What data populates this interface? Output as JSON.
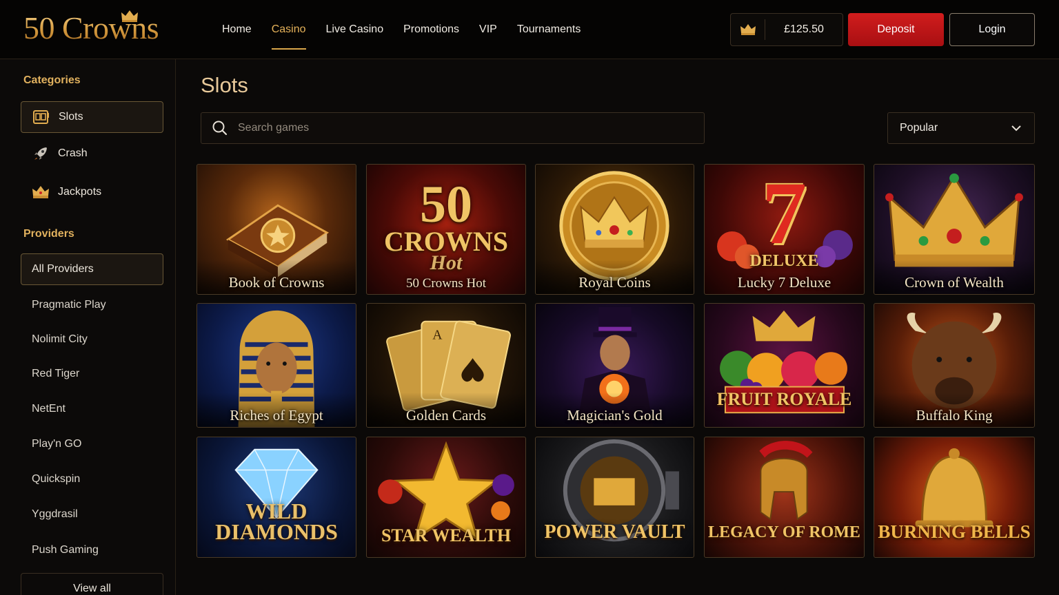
{
  "brand": {
    "name": "50 Crowns"
  },
  "nav": {
    "items": [
      {
        "label": "Home",
        "active": false
      },
      {
        "label": "Casino",
        "active": true
      },
      {
        "label": "Live Casino",
        "active": false
      },
      {
        "label": "Promotions",
        "active": false
      },
      {
        "label": "VIP",
        "active": false
      },
      {
        "label": "Tournaments",
        "active": false
      }
    ]
  },
  "account": {
    "balance": "£125.50",
    "deposit_label": "Deposit",
    "login_label": "Login"
  },
  "sidebar": {
    "categories_heading": "Categories",
    "categories": [
      {
        "label": "Slots",
        "icon": "slot-machine-icon",
        "active": true
      },
      {
        "label": "Crash",
        "icon": "rocket-icon",
        "active": false
      },
      {
        "label": "Jackpots",
        "icon": "crown-icon",
        "active": false
      }
    ],
    "providers_heading": "Providers",
    "providers": [
      "All Providers",
      "Pragmatic Play",
      "Nolimit City",
      "Red Tiger",
      "NetEnt",
      "Play'n GO",
      "Quickspin",
      "Yggdrasil",
      "Push Gaming"
    ],
    "view_all_label": "View all"
  },
  "main": {
    "title": "Slots",
    "search_placeholder": "Search games",
    "sort_value": "Popular",
    "games": [
      {
        "title": "Book of Crowns",
        "art_text": ""
      },
      {
        "title": "50 Crowns Hot",
        "art_text": "50 CROWNS",
        "art_sub": "Hot"
      },
      {
        "title": "Royal Coins",
        "art_text": ""
      },
      {
        "title": "Lucky 7 Deluxe",
        "art_text": "7",
        "art_sub": "DELUXE"
      },
      {
        "title": "Crown of Wealth",
        "art_text": ""
      },
      {
        "title": "Riches of Egypt",
        "art_text": ""
      },
      {
        "title": "Golden Cards",
        "art_text": ""
      },
      {
        "title": "Magician's Gold",
        "art_text": ""
      },
      {
        "title": "",
        "art_text": "FRUIT ROYALE"
      },
      {
        "title": "Buffalo King",
        "art_text": ""
      },
      {
        "title": "",
        "art_text": "WILD DIAMONDS"
      },
      {
        "title": "",
        "art_text": "STAR WEALTH"
      },
      {
        "title": "",
        "art_text": "POWER VAULT"
      },
      {
        "title": "",
        "art_text": "LEGACY OF ROME"
      },
      {
        "title": "",
        "art_text": "BURNING BELLS"
      }
    ]
  },
  "colors": {
    "accent_gold": "#d9a64a",
    "deposit_red": "#c4161a",
    "background": "#0b0908"
  }
}
